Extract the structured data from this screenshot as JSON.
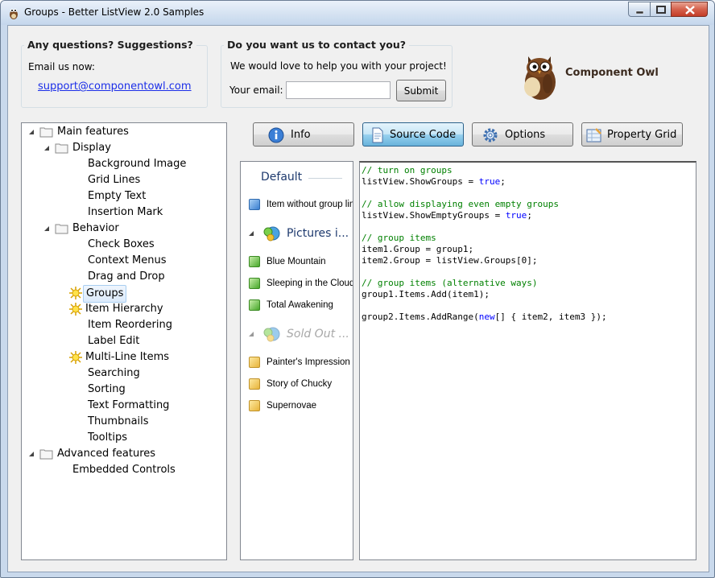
{
  "window": {
    "title": "Groups - Better ListView 2.0 Samples"
  },
  "questions": {
    "title": "Any questions? Suggestions?",
    "email_label": "Email us now:",
    "link": "support@componentowl.com"
  },
  "contact": {
    "title": "Do you want us to contact you?",
    "text": "We would love to help you with your project!",
    "email_label": "Your email:",
    "email_value": "",
    "submit": "Submit"
  },
  "brand": {
    "name": "Component Owl"
  },
  "tree": {
    "n0": "Main features",
    "n1": "Display",
    "n2": "Background Image",
    "n3": "Grid Lines",
    "n4": "Empty Text",
    "n5": "Insertion Mark",
    "n6": "Behavior",
    "n7": "Check Boxes",
    "n8": "Context Menus",
    "n9": "Drag and Drop",
    "n10": "Groups",
    "n11": "Item Hierarchy",
    "n12": "Item Reordering",
    "n13": "Label Edit",
    "n14": "Multi-Line Items",
    "n15": "Searching",
    "n16": "Sorting",
    "n17": "Text Formatting",
    "n18": "Thumbnails",
    "n19": "Tooltips",
    "n20": "Advanced features",
    "n21": "Embedded Controls",
    "selected": "Groups"
  },
  "toolbar": {
    "info": "Info",
    "source": "Source Code",
    "options": "Options",
    "property": "Property Grid"
  },
  "listview": {
    "group_default": "Default",
    "item_default": "Item without group lin",
    "group_pictures": "Pictures i...",
    "item_p1": "Blue Mountain",
    "item_p2": "Sleeping in the Cloud",
    "item_p3": "Total Awakening",
    "group_sold": "Sold Out ...",
    "item_s1": "Painter's Impression",
    "item_s2": "Story of Chucky",
    "item_s3": "Supernovae"
  },
  "code": {
    "l1": "// turn on groups",
    "l2a": "listView.ShowGroups = ",
    "l2b": "true",
    "l2c": ";",
    "l4": "// allow displaying even empty groups",
    "l5a": "listView.ShowEmptyGroups = ",
    "l5b": "true",
    "l5c": ";",
    "l7": "// group items",
    "l8": "item1.Group = group1;",
    "l9": "item2.Group = listView.Groups[0];",
    "l11": "// group items (alternative ways)",
    "l12": "group1.Items.Add(item1);",
    "l14a": "group2.Items.AddRange(",
    "l14b": "new",
    "l14c": "[] { item2, item3 });"
  },
  "colors": {
    "comment": "#008000",
    "keyword": "#0000ff",
    "link": "#1b2ee8",
    "selected_button": "#98d1ef"
  }
}
